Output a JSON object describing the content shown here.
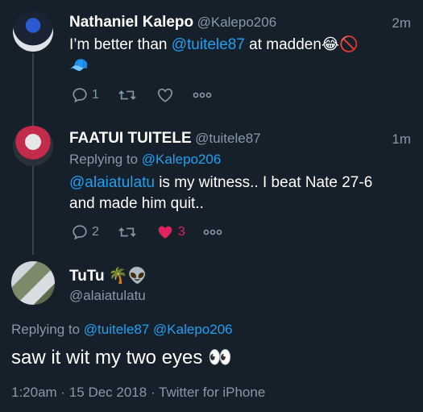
{
  "tweets": [
    {
      "name": "Nathaniel Kalepo",
      "handle": "@Kalepo206",
      "time": "2m",
      "text_pre": "I’m better than ",
      "mention": "@tuitele87",
      "text_post": " at madden😂🚫",
      "text_line2": "🧢",
      "replies": "1",
      "retweets": "",
      "likes": ""
    },
    {
      "name": "FAATUI TUITELE",
      "handle": "@tuitele87",
      "time": "1m",
      "replying_label": "Replying to ",
      "replying_to": "@Kalepo206",
      "mention": "@alaiatulatu",
      "text_line1_post": " is my witness.. I beat Nate 27-6",
      "text_line2": "and made him quit..",
      "replies": "2",
      "likes": "3"
    }
  ],
  "main_tweet": {
    "name": "TuTu 🌴👽",
    "handle": "@alaiatulatu",
    "replying_label": "Replying to ",
    "replying_to_1": "@tuitele87",
    "replying_to_2": "@Kalepo206",
    "text": "saw it wit my two eyes 👀",
    "meta": "1:20am · 15 Dec 2018 · Twitter for iPhone"
  },
  "icons": {
    "reply": "reply-icon",
    "retweet": "retweet-icon",
    "like": "heart-icon",
    "more": "more-icon"
  },
  "colors": {
    "background": "#15202b",
    "link": "#1da1f2",
    "muted": "#8899a6",
    "like": "#e0245e"
  }
}
